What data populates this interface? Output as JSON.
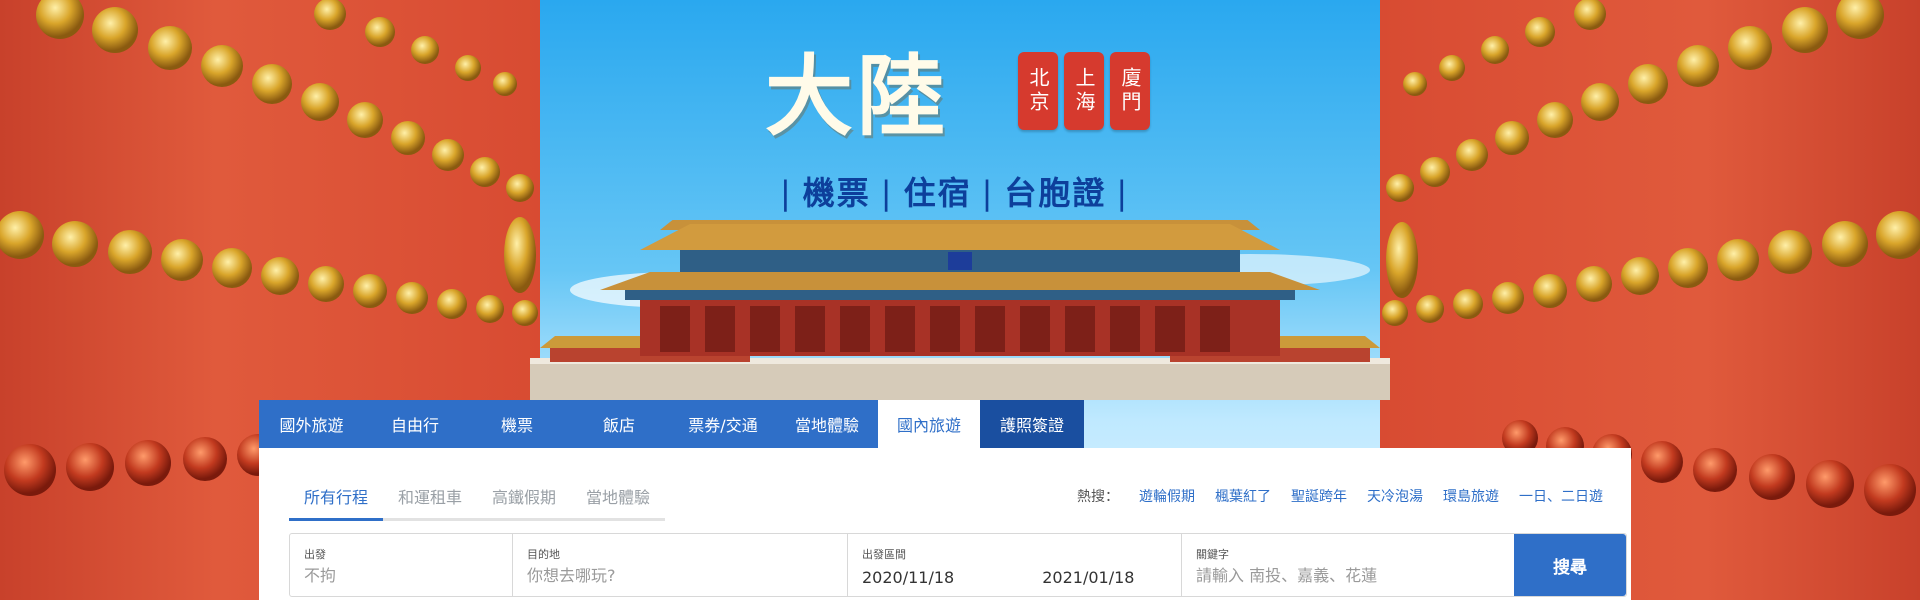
{
  "banner": {
    "title": "大陸",
    "cities": [
      "北京",
      "上海",
      "廈門"
    ],
    "services": [
      "機票",
      "住宿",
      "台胞證"
    ],
    "colors": {
      "sky": "#2aa8ef",
      "wall": "#d84b32",
      "brand_blue": "#2f6fc8",
      "headline_blue": "#0d3f9b"
    }
  },
  "main_tabs": [
    {
      "label": "國外旅遊"
    },
    {
      "label": "自由行"
    },
    {
      "label": "機票"
    },
    {
      "label": "飯店"
    },
    {
      "label": "票券/交通"
    },
    {
      "label": "當地體驗"
    },
    {
      "label": "國內旅遊",
      "active": true
    },
    {
      "label": "護照簽證"
    }
  ],
  "sub_tabs": [
    {
      "label": "所有行程",
      "active": true
    },
    {
      "label": "和運租車"
    },
    {
      "label": "高鐵假期"
    },
    {
      "label": "當地體驗"
    }
  ],
  "hot_search": {
    "label": "熱搜：",
    "items": [
      "遊輪假期",
      "楓葉紅了",
      "聖誕跨年",
      "天冷泡湯",
      "環島旅遊",
      "一日、二日遊"
    ]
  },
  "search": {
    "depart": {
      "label": "出發",
      "placeholder": "不拘"
    },
    "destination": {
      "label": "目的地",
      "placeholder": "你想去哪玩?"
    },
    "date_range": {
      "label": "出發區間",
      "start": "2020/11/18",
      "end": "2021/01/18"
    },
    "keyword": {
      "label": "關鍵字",
      "placeholder": "請輸入 南投、嘉義、花蓮"
    },
    "button_label": "搜尋"
  }
}
